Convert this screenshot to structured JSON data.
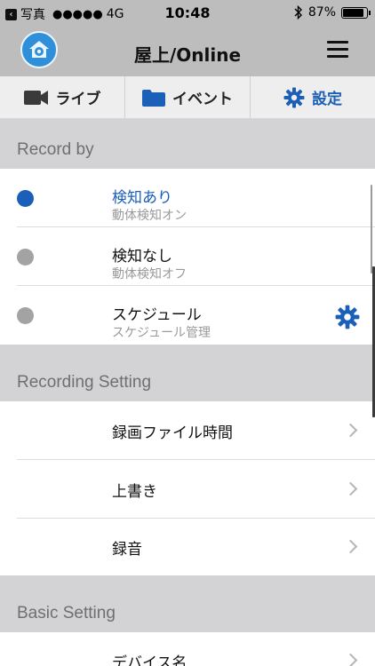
{
  "status_bar": {
    "back_app": "写真",
    "signal": "●●●●●",
    "network": "4G",
    "time": "10:48",
    "battery": "87%",
    "battery_level": 0.87
  },
  "nav": {
    "title": "屋上/Online"
  },
  "tabs": [
    {
      "label": "ライブ",
      "icon": "video-camera-icon"
    },
    {
      "label": "イベント",
      "icon": "folder-icon"
    },
    {
      "label": "設定",
      "icon": "gear-icon"
    }
  ],
  "record_by": {
    "header": "Record by",
    "options": [
      {
        "label": "検知あり",
        "sub": "動体検知オン",
        "selected": true
      },
      {
        "label": "検知なし",
        "sub": "動体検知オフ",
        "selected": false
      },
      {
        "label": "スケジュール",
        "sub": "スケジュール管理",
        "selected": false
      }
    ]
  },
  "recording_setting": {
    "header": "Recording Setting",
    "items": [
      "録画ファイル時間",
      "上書き",
      "録音"
    ]
  },
  "basic_setting": {
    "header": "Basic Setting",
    "items": [
      "デバイス名"
    ]
  },
  "colors": {
    "accent": "#1b5fb8",
    "header_bg": "#bdbdbd",
    "section_bg": "#d3d3d5"
  }
}
